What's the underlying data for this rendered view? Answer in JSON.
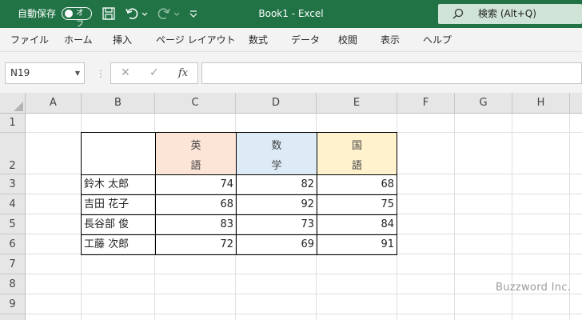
{
  "titlebar": {
    "autosave_label": "自動保存",
    "autosave_state": "オフ",
    "title": "Book1  -  Excel",
    "search_placeholder": "検索 (Alt+Q)"
  },
  "menu": [
    "ファイル",
    "ホーム",
    "挿入",
    "ページ レイアウト",
    "数式",
    "データ",
    "校閲",
    "表示",
    "ヘルプ"
  ],
  "formula_bar": {
    "name_box": "N19",
    "fx": "fx",
    "formula": ""
  },
  "columns": [
    "A",
    "B",
    "C",
    "D",
    "E",
    "F",
    "G",
    "H"
  ],
  "rows": [
    "1",
    "2",
    "3",
    "4",
    "5",
    "6",
    "7",
    "8",
    "9"
  ],
  "table": {
    "headers": [
      {
        "line1": "英",
        "line2": "語",
        "color": "#fce4d6"
      },
      {
        "line1": "数",
        "line2": "学",
        "color": "#ddebf7"
      },
      {
        "line1": "国",
        "line2": "語",
        "color": "#fff2cc"
      }
    ],
    "students": [
      {
        "name": "鈴木 太郎",
        "scores": [
          "74",
          "82",
          "68"
        ]
      },
      {
        "name": "吉田 花子",
        "scores": [
          "68",
          "92",
          "75"
        ]
      },
      {
        "name": "長谷部 俊",
        "scores": [
          "83",
          "73",
          "84"
        ]
      },
      {
        "name": "工藤 次郎",
        "scores": [
          "72",
          "69",
          "91"
        ]
      }
    ]
  },
  "watermark": "Buzzword Inc.",
  "colors": {
    "accent": "#217346"
  }
}
